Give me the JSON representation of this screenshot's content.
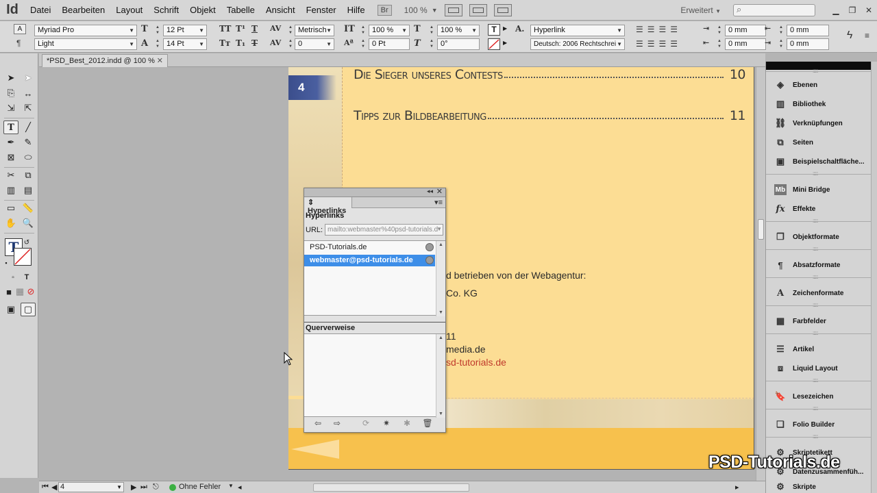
{
  "app": {
    "logo": "Id",
    "menu": [
      "Datei",
      "Bearbeiten",
      "Layout",
      "Schrift",
      "Objekt",
      "Tabelle",
      "Ansicht",
      "Fenster",
      "Hilfe"
    ],
    "bridge": "Br",
    "zoom": "100 %",
    "workspace": "Erweitert"
  },
  "control_panel": {
    "font_family": "Myriad Pro",
    "font_style": "Light",
    "font_size": "12 Pt",
    "leading": "14 Pt",
    "kerning": "Metrisch",
    "tracking": "0",
    "vertical_scale": "100 %",
    "horizontal_scale": "100 %",
    "baseline_shift": "0 Pt",
    "skew": "0°",
    "char_style": "Hyperlink",
    "language": "Deutsch: 2006 Rechtschrei",
    "indent_left": "0 mm",
    "indent_right": "0 mm",
    "indent_first": "0 mm",
    "indent_last": "0 mm"
  },
  "document": {
    "tab_title": "*PSD_Best_2012.indd @ 100 %",
    "page_badge": "4",
    "toc": [
      {
        "title": "Die Sieger unseres Contests",
        "page": "10"
      },
      {
        "title": "Tipps zur Bildbearbeitung",
        "page": "11"
      }
    ],
    "body_lines": [
      "d betrieben von der Webagentur:",
      "Co. KG",
      "11",
      "media.de",
      "sd-tutorials.de"
    ]
  },
  "hyperlinks_panel": {
    "tab": "Hyperlinks",
    "heading": "Hyperlinks",
    "url_label": "URL:",
    "url_value": "mailto:webmaster%40psd-tutorials.d",
    "items": [
      "PSD-Tutorials.de",
      "webmaster@psd-tutorials.de"
    ],
    "selected_index": 1,
    "xref_heading": "Querverweise"
  },
  "right_panels": [
    {
      "label": "Ebenen",
      "icon": "layers-icon"
    },
    {
      "label": "Bibliothek",
      "icon": "library-icon"
    },
    {
      "label": "Verknüpfungen",
      "icon": "links-icon"
    },
    {
      "label": "Seiten",
      "icon": "pages-icon"
    },
    {
      "label": "Beispielschaltfläche...",
      "icon": "sample-button-icon"
    },
    {
      "label": "Mini Bridge",
      "icon": "mini-bridge-icon"
    },
    {
      "label": "Effekte",
      "icon": "effects-icon"
    },
    {
      "label": "Objektformate",
      "icon": "object-styles-icon"
    },
    {
      "label": "Absatzformate",
      "icon": "paragraph-styles-icon"
    },
    {
      "label": "Zeichenformate",
      "icon": "character-styles-icon"
    },
    {
      "label": "Farbfelder",
      "icon": "swatches-icon"
    },
    {
      "label": "Artikel",
      "icon": "articles-icon"
    },
    {
      "label": "Liquid Layout",
      "icon": "liquid-layout-icon"
    },
    {
      "label": "Lesezeichen",
      "icon": "bookmarks-icon"
    },
    {
      "label": "Folio Builder",
      "icon": "folio-builder-icon"
    },
    {
      "label": "Skriptetikett",
      "icon": "script-label-icon"
    },
    {
      "label": "Datenzusammenfüh...",
      "icon": "data-merge-icon"
    },
    {
      "label": "Skripte",
      "icon": "scripts-icon"
    }
  ],
  "status_bar": {
    "page": "4",
    "preflight": "Ohne Fehler"
  },
  "watermark": "PSD-Tutorials.de"
}
